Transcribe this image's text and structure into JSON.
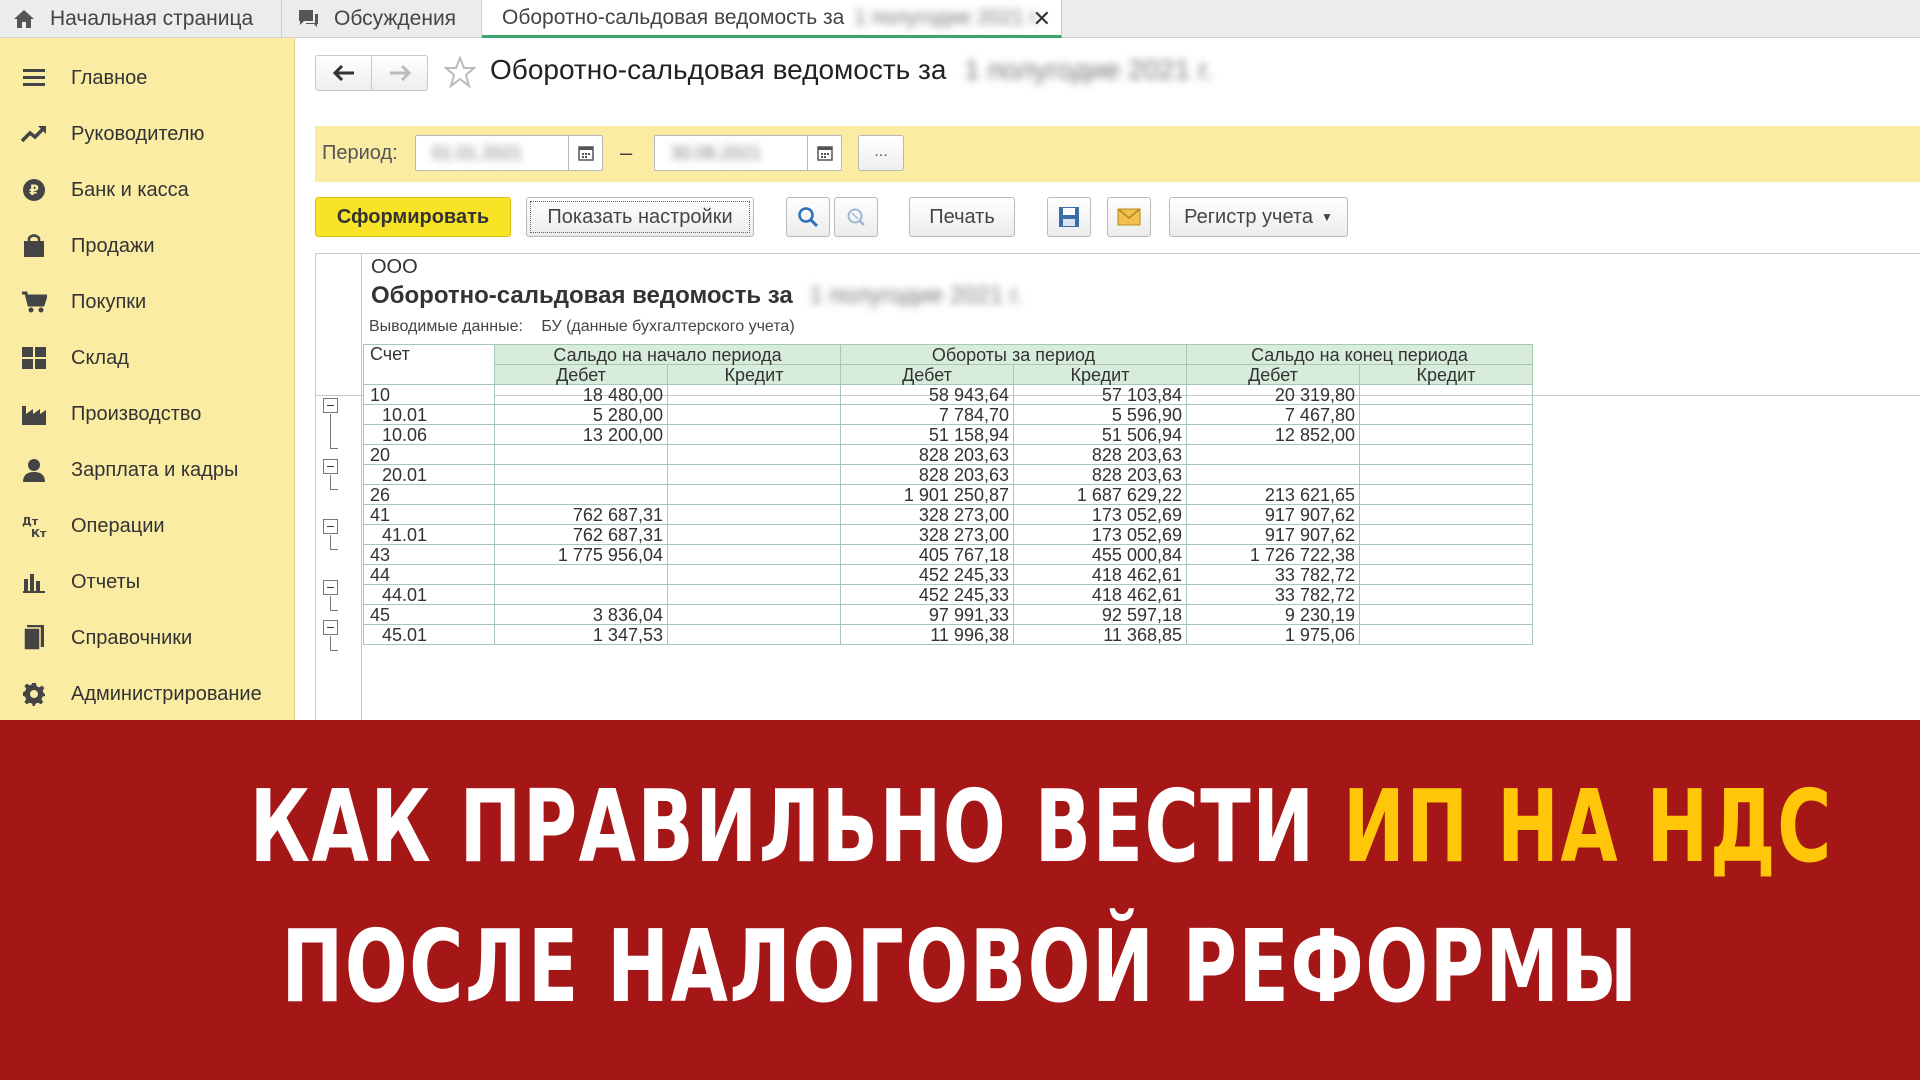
{
  "tabs": {
    "home": "Начальная страница",
    "discussions": "Обсуждения",
    "active": "Оборотно-сальдовая ведомость за",
    "active_blurred": "1 полугодие 2021 г."
  },
  "sidebar": {
    "items": [
      {
        "label": "Главное",
        "icon": "menu-icon"
      },
      {
        "label": "Руководителю",
        "icon": "trend-icon"
      },
      {
        "label": "Банк и касса",
        "icon": "ruble-icon"
      },
      {
        "label": "Продажи",
        "icon": "bag-icon"
      },
      {
        "label": "Покупки",
        "icon": "cart-icon"
      },
      {
        "label": "Склад",
        "icon": "warehouse-icon"
      },
      {
        "label": "Производство",
        "icon": "factory-icon"
      },
      {
        "label": "Зарплата и кадры",
        "icon": "person-icon"
      },
      {
        "label": "Операции",
        "icon": "debit-credit-icon"
      },
      {
        "label": "Отчеты",
        "icon": "bar-chart-icon"
      },
      {
        "label": "Справочники",
        "icon": "book-icon"
      },
      {
        "label": "Администрирование",
        "icon": "gear-icon"
      }
    ]
  },
  "form": {
    "title": "Оборотно-сальдовая ведомость за",
    "title_blurred": "1 полугодие 2021 г.",
    "period_label": "Период:",
    "date_from": "01.01.2021",
    "date_to": "30.06.2021",
    "dash": "–",
    "dots": "..."
  },
  "toolbar": {
    "generate": "Сформировать",
    "show_settings": "Показать настройки",
    "print": "Печать",
    "register": "Регистр учета"
  },
  "report": {
    "org": "ООО",
    "title": "Оборотно-сальдовая ведомость за",
    "title_blurred": "1 полугодие 2021 г.",
    "output_label": "Выводимые данные:",
    "output_value": "БУ (данные бухгалтерского учета)",
    "headers": {
      "account": "Счет",
      "opening": "Сальдо на начало периода",
      "turnover": "Обороты за период",
      "closing": "Сальдо на конец периода",
      "debit": "Дебет",
      "credit": "Кредит"
    },
    "rows": [
      {
        "acc": "10",
        "sub": false,
        "od": "18 480,00",
        "oc": "",
        "td": "58 943,64",
        "tc": "57 103,84",
        "cd": "20 319,80",
        "cc": ""
      },
      {
        "acc": "10.01",
        "sub": true,
        "od": "5 280,00",
        "oc": "",
        "td": "7 784,70",
        "tc": "5 596,90",
        "cd": "7 467,80",
        "cc": ""
      },
      {
        "acc": "10.06",
        "sub": true,
        "od": "13 200,00",
        "oc": "",
        "td": "51 158,94",
        "tc": "51 506,94",
        "cd": "12 852,00",
        "cc": ""
      },
      {
        "acc": "20",
        "sub": false,
        "od": "",
        "oc": "",
        "td": "828 203,63",
        "tc": "828 203,63",
        "cd": "",
        "cc": ""
      },
      {
        "acc": "20.01",
        "sub": true,
        "od": "",
        "oc": "",
        "td": "828 203,63",
        "tc": "828 203,63",
        "cd": "",
        "cc": ""
      },
      {
        "acc": "26",
        "sub": false,
        "od": "",
        "oc": "",
        "td": "1 901 250,87",
        "tc": "1 687 629,22",
        "cd": "213 621,65",
        "cc": ""
      },
      {
        "acc": "41",
        "sub": false,
        "od": "762 687,31",
        "oc": "",
        "td": "328 273,00",
        "tc": "173 052,69",
        "cd": "917 907,62",
        "cc": ""
      },
      {
        "acc": "41.01",
        "sub": true,
        "od": "762 687,31",
        "oc": "",
        "td": "328 273,00",
        "tc": "173 052,69",
        "cd": "917 907,62",
        "cc": ""
      },
      {
        "acc": "43",
        "sub": false,
        "od": "1 775 956,04",
        "oc": "",
        "td": "405 767,18",
        "tc": "455 000,84",
        "cd": "1 726 722,38",
        "cc": ""
      },
      {
        "acc": "44",
        "sub": false,
        "od": "",
        "oc": "",
        "td": "452 245,33",
        "tc": "418 462,61",
        "cd": "33 782,72",
        "cc": ""
      },
      {
        "acc": "44.01",
        "sub": true,
        "od": "",
        "oc": "",
        "td": "452 245,33",
        "tc": "418 462,61",
        "cd": "33 782,72",
        "cc": ""
      },
      {
        "acc": "45",
        "sub": false,
        "od": "3 836,04",
        "oc": "",
        "td": "97 991,33",
        "tc": "92 597,18",
        "cd": "9 230,19",
        "cc": ""
      },
      {
        "acc": "45.01",
        "sub": true,
        "od": "1 347,53",
        "oc": "",
        "td": "11 996,38",
        "tc": "11 368,85",
        "cd": "1 975,06",
        "cc": ""
      }
    ]
  },
  "banner": {
    "line1_white": "КАК ПРАВИЛЬНО ВЕСТИ",
    "line1_yellow": "ИП НА НДС",
    "line2": "ПОСЛЕ НАЛОГОВОЙ РЕФОРМЫ",
    "bg_color": "#a51616",
    "highlight_color": "#ffc60a"
  }
}
